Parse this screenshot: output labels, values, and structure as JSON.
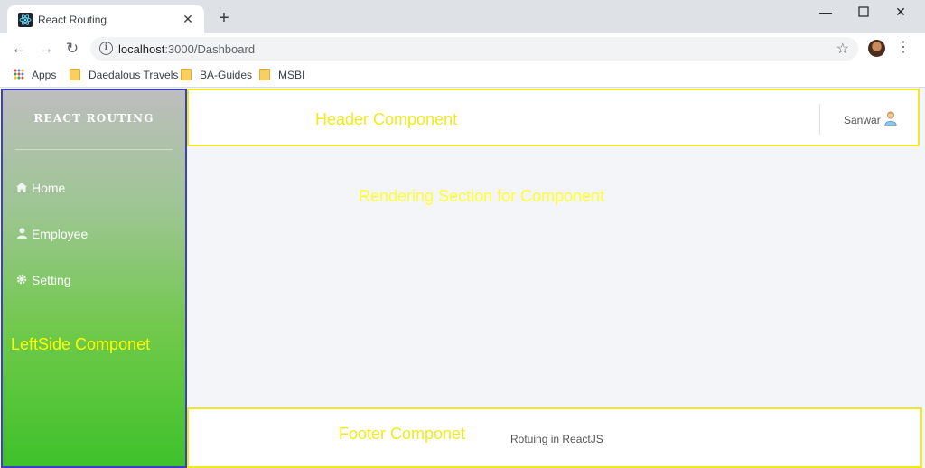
{
  "browser": {
    "tab_title": "React Routing",
    "close_glyph": "✕",
    "new_tab_glyph": "+",
    "url_host": "localhost",
    "url_path": ":3000/Dashboard",
    "bookmarks": [
      "Apps",
      "Daedalous Travels",
      "BA-Guides",
      "MSBI"
    ]
  },
  "sidebar": {
    "brand": "REACT ROUTING",
    "items": [
      {
        "label": "Home",
        "icon": "home-icon"
      },
      {
        "label": "Employee",
        "icon": "user-icon"
      },
      {
        "label": "Setting",
        "icon": "gear-icon"
      }
    ],
    "annotation": "LeftSide Componet"
  },
  "header": {
    "annotation": "Header Component",
    "user_name": "Sanwar"
  },
  "content": {
    "annotation": "Rendering Section for Component"
  },
  "footer": {
    "annotation": "Footer Componet",
    "text": "Rotuing in ReactJS"
  },
  "colors": {
    "annotation": "#f2ea1a",
    "sidebar_border": "#3b3fc4",
    "sidebar_top": "#bdbdbd",
    "sidebar_bottom": "#3fc12a"
  }
}
